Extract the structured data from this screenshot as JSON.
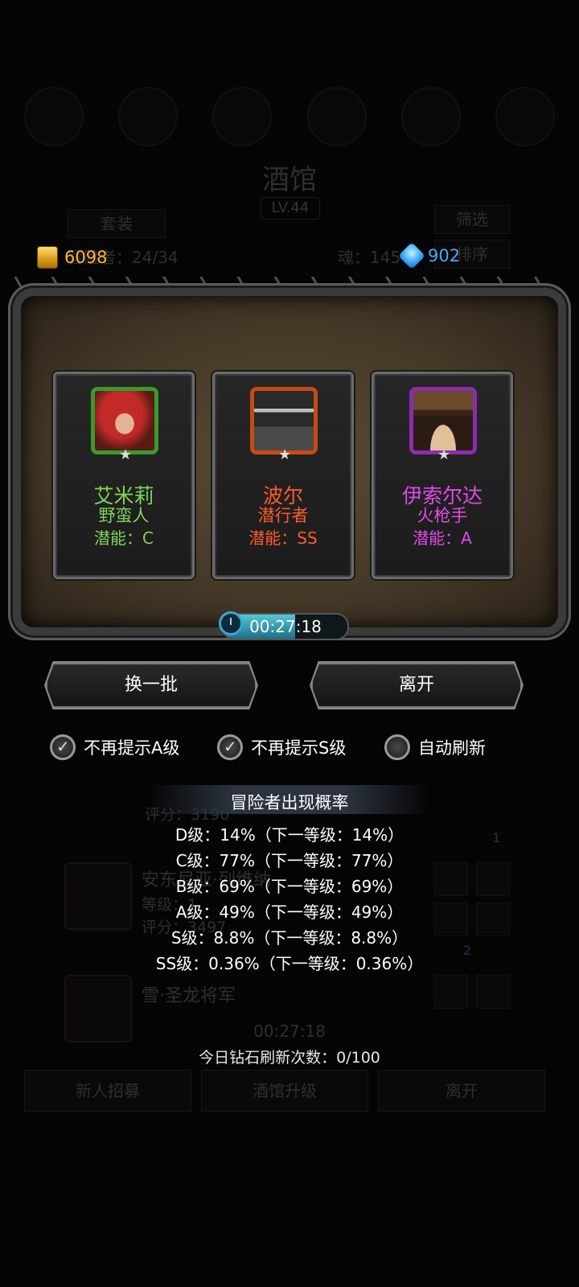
{
  "background": {
    "title": "酒馆",
    "level": "LV.44",
    "btn_set": "套装",
    "btn_filter": "筛选",
    "btn_sort": "排序",
    "adventurers": "冒险者：24/34",
    "soul": "魂：145",
    "row1_score": "评分：3190",
    "row2_name": "安东尼亚·列维纳",
    "row2_level": "等级：1",
    "row2_score": "评分：3497",
    "row3_name": "雪·圣龙将军",
    "timer": "00:27:18",
    "btn_recruit": "新人招募",
    "btn_upgrade": "酒馆升级",
    "btn_leave": "离开",
    "slot_badge1": "1",
    "slot_badge2": "2"
  },
  "currency": {
    "gold": "6098",
    "gems": "902"
  },
  "cards": [
    {
      "name": "艾米莉",
      "class": "野蛮人",
      "potential": "潜能：C",
      "color": "#7fd45a",
      "frame": "#3a9a2a"
    },
    {
      "name": "波尔",
      "class": "潜行者",
      "potential": "潜能：SS",
      "color": "#ff5a2a",
      "frame": "#c84a14"
    },
    {
      "name": "伊索尔达",
      "class": "火枪手",
      "potential": "潜能：A",
      "color": "#e04be6",
      "frame": "#8a2cb0"
    }
  ],
  "timer": "00:27:18",
  "buttons": {
    "refresh": "换一批",
    "leave": "离开"
  },
  "options": [
    {
      "label": "不再提示A级",
      "checked": true
    },
    {
      "label": "不再提示S级",
      "checked": true
    },
    {
      "label": "自动刷新",
      "checked": false
    }
  ],
  "probability": {
    "title": "冒险者出现概率",
    "lines": [
      "D级：14%（下一等级：14%）",
      "C级：77%（下一等级：77%）",
      "B级：69%（下一等级：69%）",
      "A级：49%（下一等级：49%）",
      "S级：8.8%（下一等级：8.8%）",
      "SS级：0.36%（下一等级：0.36%）"
    ]
  },
  "daily_refresh": "今日钻石刷新次数：0/100"
}
